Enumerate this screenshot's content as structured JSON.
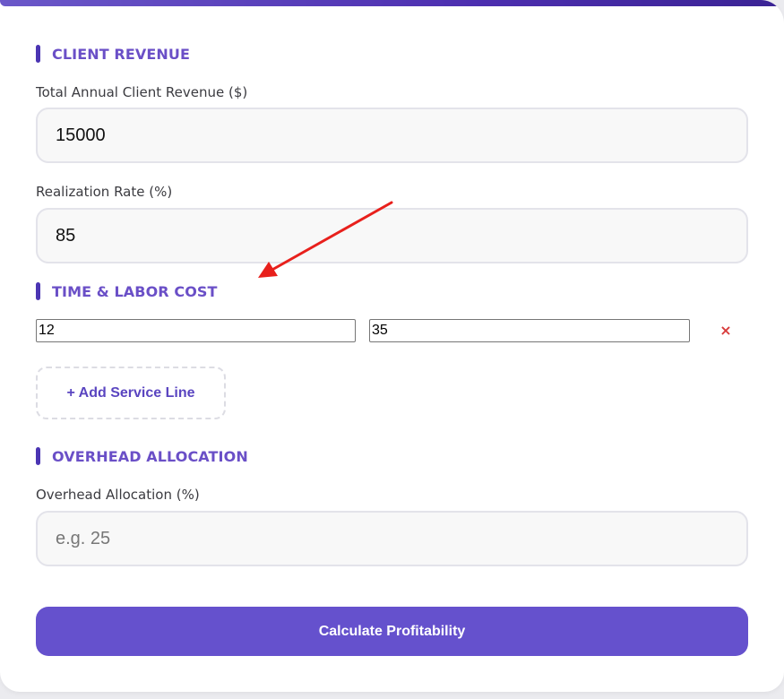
{
  "client_revenue": {
    "section_title": "CLIENT REVENUE",
    "annual_revenue": {
      "label": "Total Annual Client Revenue ($)",
      "value": "15000",
      "placeholder": ""
    },
    "realization_rate": {
      "label": "Realization Rate (%)",
      "value": "85",
      "placeholder": ""
    }
  },
  "time_labor": {
    "section_title": "TIME & LABOR COST",
    "service_lines": [
      {
        "hours": "12",
        "rate": "35",
        "remove_label": "×"
      }
    ],
    "add_label": "+ Add Service Line"
  },
  "overhead": {
    "section_title": "OVERHEAD ALLOCATION",
    "allocation": {
      "label": "Overhead Allocation (%)",
      "value": "",
      "placeholder": "e.g. 25"
    }
  },
  "calculate_label": "Calculate Profitability",
  "colors": {
    "accent": "#6551cd",
    "section_title": "#6a4fc7",
    "remove": "#d83a3a",
    "annotation_arrow": "#e8201c"
  }
}
